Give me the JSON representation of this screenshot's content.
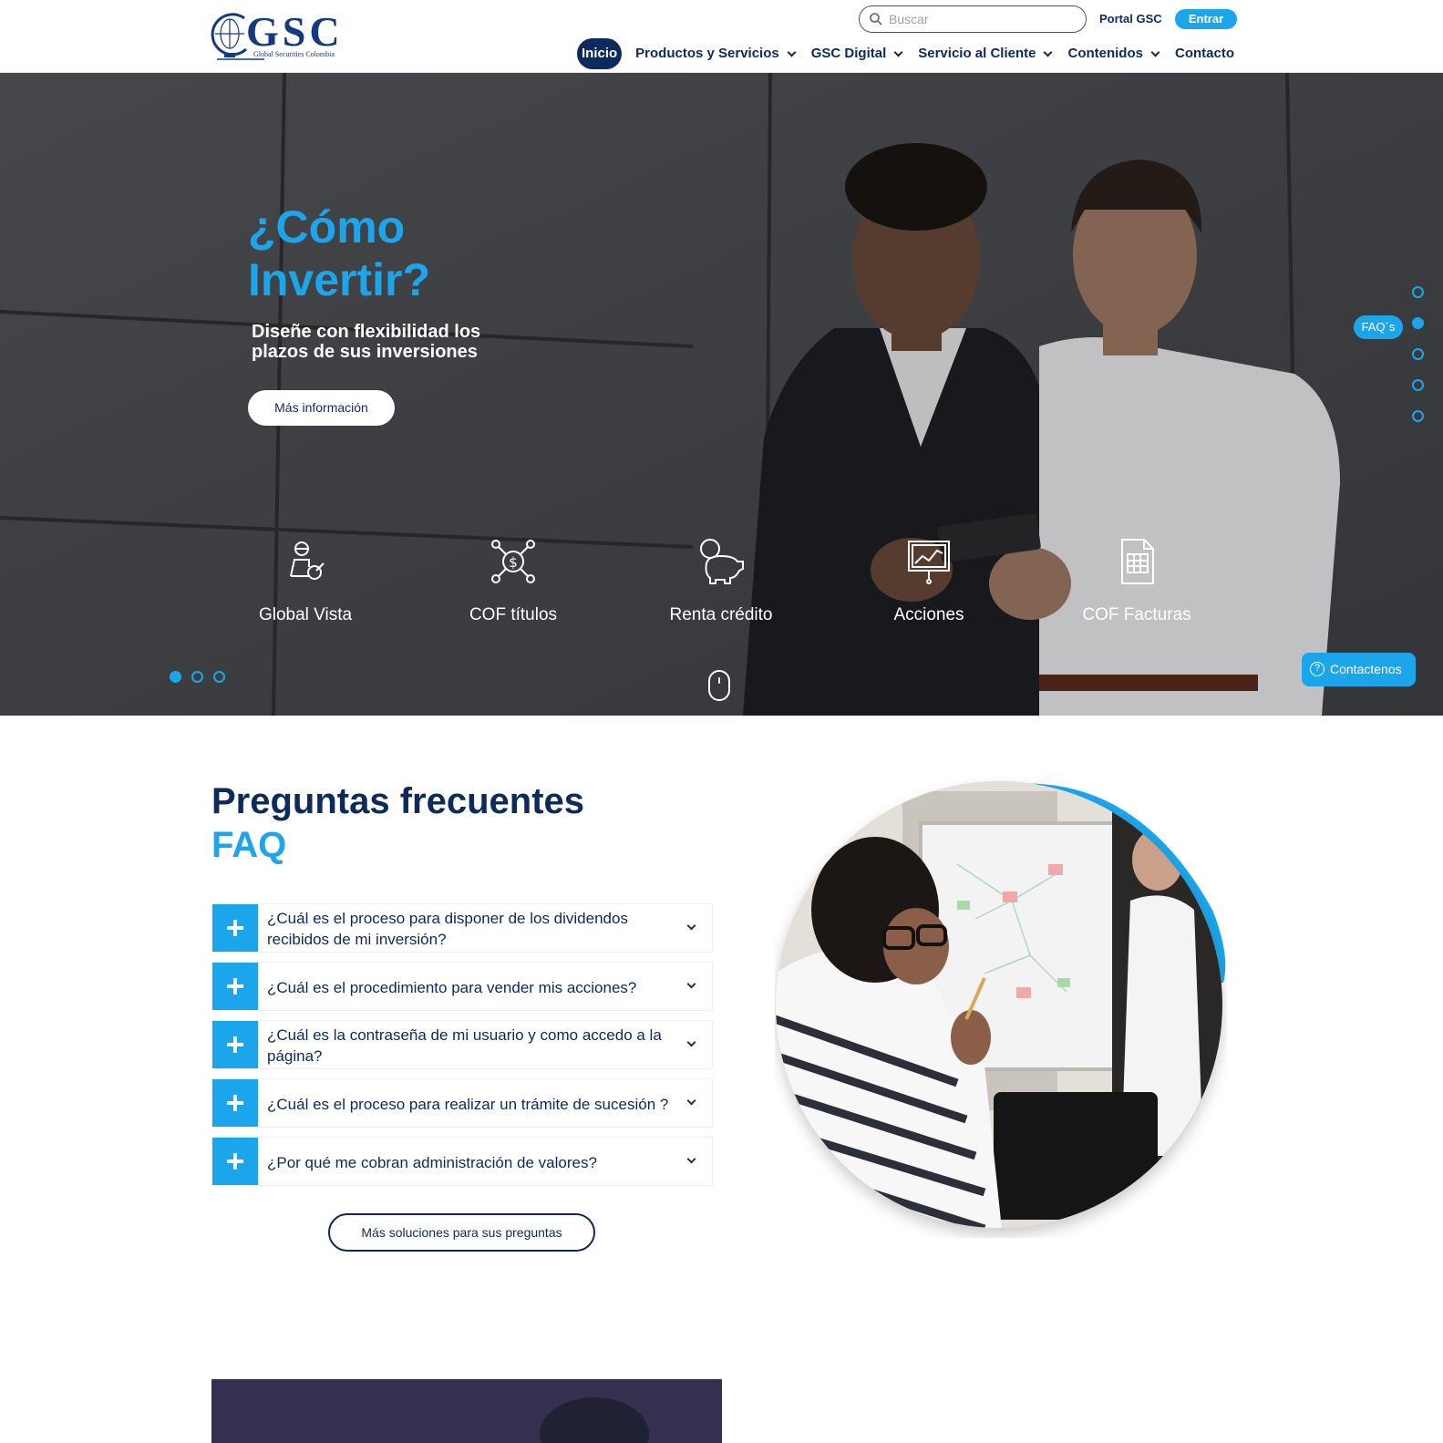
{
  "header": {
    "logo_text": "GSC",
    "logo_subtitle": "Global Securities Colombia",
    "search_placeholder": "Buscar",
    "portal_label": "Portal GSC",
    "login_label": "Entrar",
    "nav": [
      {
        "label": "Inicio",
        "active": true
      },
      {
        "label": "Productos y Servicios",
        "dropdown": true
      },
      {
        "label": "GSC Digital",
        "dropdown": true
      },
      {
        "label": "Servicio al Cliente",
        "dropdown": true
      },
      {
        "label": "Contenidos",
        "dropdown": true
      },
      {
        "label": "Contacto"
      }
    ]
  },
  "hero": {
    "title": "¿Cómo Invertir?",
    "subtitle": "Diseñe con flexibilidad los plazos de sus inversiones",
    "button_label": "Más información",
    "services": [
      {
        "label": "Global Vista",
        "icon": "person-advisor-icon"
      },
      {
        "label": "COF títulos",
        "icon": "dollar-network-icon"
      },
      {
        "label": "Renta crédito",
        "icon": "piggy-bank-icon"
      },
      {
        "label": "Acciones",
        "icon": "chart-board-icon"
      },
      {
        "label": "COF Facturas",
        "icon": "invoice-document-icon"
      }
    ],
    "slider": {
      "total": 3,
      "active": 0
    },
    "side_nav": {
      "total": 5,
      "active": 1,
      "tag": "FAQ´s"
    },
    "contact_label": "Contactenos"
  },
  "faq": {
    "title": "Preguntas frecuentes",
    "subtitle": "FAQ",
    "questions": [
      "¿Cuál es el proceso para disponer de los dividendos recibidos de mi inversión?",
      "¿Cuál es el procedimiento para vender mis acciones?",
      "¿Cuál es la contraseña de mi usuario y como accedo a la página?",
      "¿Cuál es el proceso para realizar un trámite de sucesión ?",
      "¿Por qué me cobran administración de valores?"
    ],
    "more_label": "Más soluciones para sus preguntas"
  },
  "colors": {
    "navy": "#0d2a5c",
    "accent": "#1ba6ec"
  }
}
